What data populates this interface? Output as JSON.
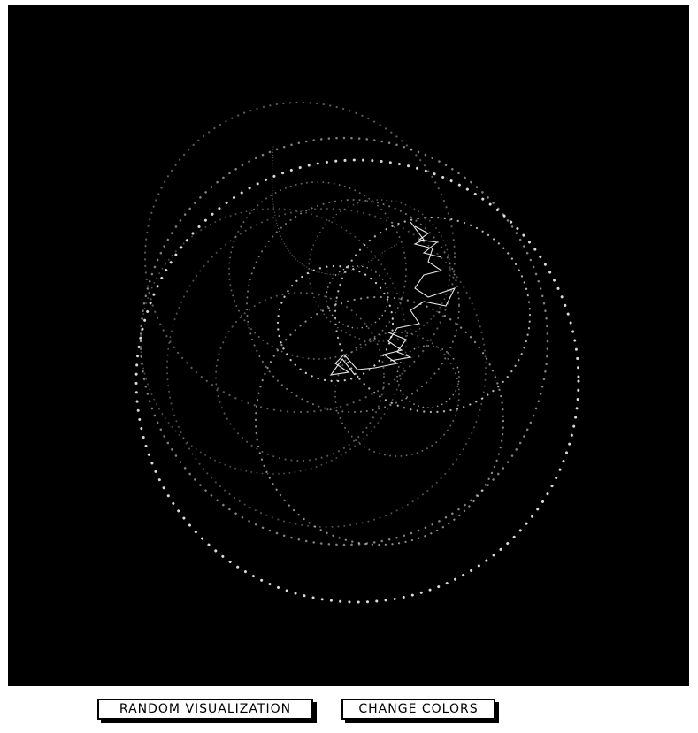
{
  "visualization": {
    "background_color": "#000000",
    "stroke_color": "#ffffff",
    "style": "dotted-orbits"
  },
  "controls": {
    "random_label": "RANDOM VISUALIZATION",
    "colors_label": "CHANGE COLORS"
  }
}
